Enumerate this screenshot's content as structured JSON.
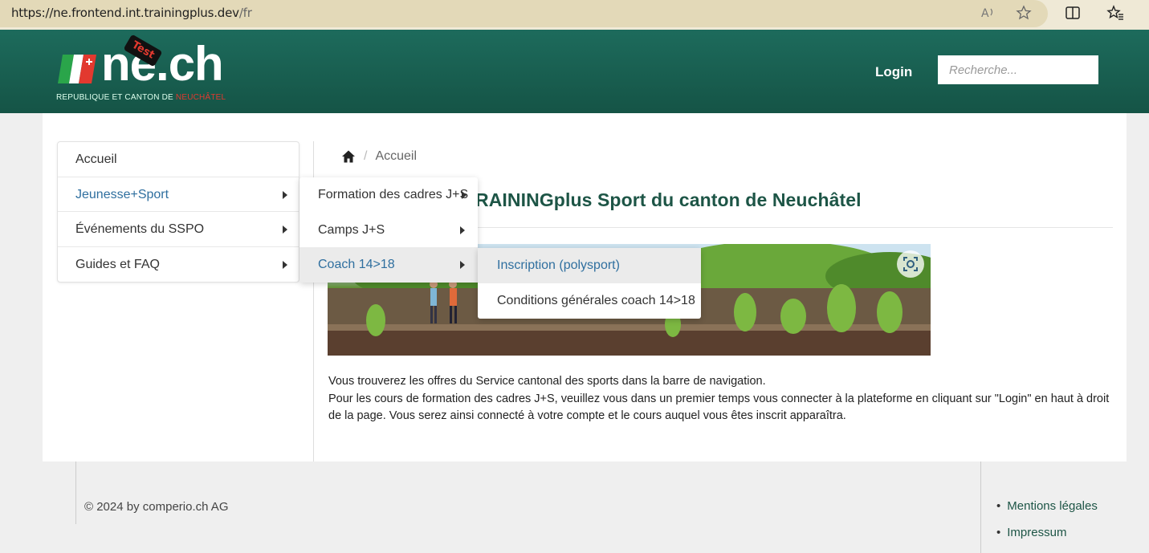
{
  "browser": {
    "url_host": "https://ne.frontend.int.trainingplus.dev",
    "url_path": "/fr",
    "icons": [
      "read-aloud-icon",
      "favorite-star-icon",
      "split-screen-icon",
      "favorites-icon"
    ]
  },
  "header": {
    "logo_text": "ne.ch",
    "logo_sub_prefix": "REPUBLIQUE ET CANTON DE ",
    "logo_sub_highlight": "NEUCHÂTEL",
    "test_badge": "Test",
    "login_label": "Login",
    "search_placeholder": "Recherche..."
  },
  "sidebar": {
    "items": [
      {
        "label": "Accueil",
        "has_submenu": false
      },
      {
        "label": "Jeunesse+Sport",
        "has_submenu": true
      },
      {
        "label": "Événements du SSPO",
        "has_submenu": true
      },
      {
        "label": "Guides et FAQ",
        "has_submenu": true
      }
    ]
  },
  "submenu_js": {
    "items": [
      {
        "label": "Formation des cadres J+S"
      },
      {
        "label": "Camps J+S"
      },
      {
        "label": "Coach 14>18"
      }
    ]
  },
  "submenu_coach": {
    "items": [
      {
        "label": "Inscription (polysport)"
      },
      {
        "label": "Conditions générales coach 14>18"
      }
    ]
  },
  "breadcrumb": {
    "current": "Accueil"
  },
  "main": {
    "title_visible": "RAININGplus Sport du canton de Neuchâtel",
    "paragraph_1": "Vous trouverez les offres du Service cantonal des sports dans la barre de navigation.",
    "paragraph_2": "Pour les cours de formation des cadres J+S, veuillez vous dans un premier temps vous connecter à la plateforme en cliquant sur \"Login\" en haut à droit de la page. Vous serez ainsi connecté à votre compte et le cours auquel vous êtes inscrit apparaîtra."
  },
  "footer": {
    "copyright": "© 2024 by comperio.ch AG",
    "links": [
      "Mentions légales",
      "Impressum"
    ]
  },
  "colors": {
    "header_green": "#1d6b5c",
    "title_green": "#1d5546",
    "link_blue": "#2f6f9f",
    "accent_red": "#e2392f"
  }
}
